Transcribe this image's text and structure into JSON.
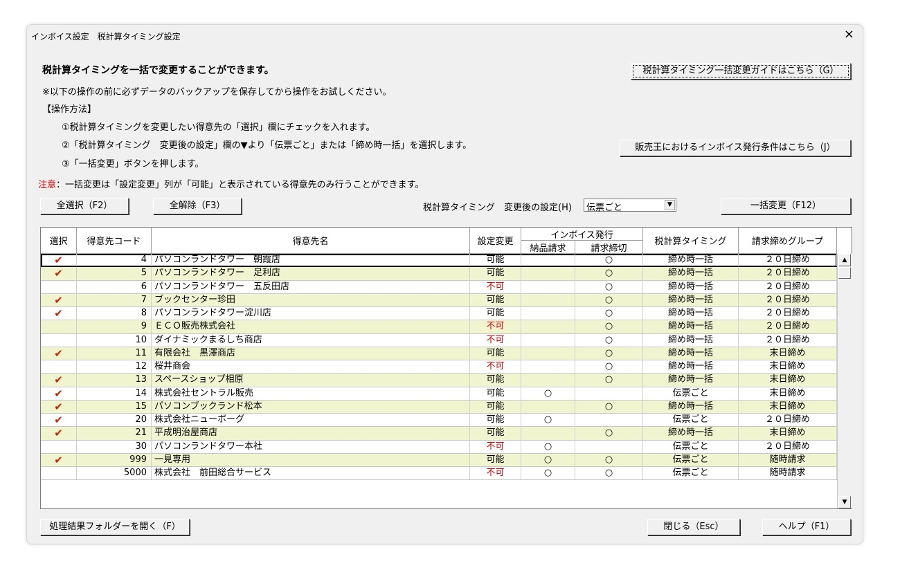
{
  "window": {
    "title": "インボイス設定　税計算タイミング設定",
    "close": "×"
  },
  "intro": {
    "heading": "税計算タイミングを一括で変更することができます。",
    "backup_note": "※以下の操作の前に必ずデータのバックアップを保存してから操作をお試しください。",
    "method_label": "【操作方法】",
    "step1": "①税計算タイミングを変更したい得意先の「選択」欄にチェックを入れます。",
    "step2": "②「税計算タイミング　変更後の設定」欄の▼より「伝票ごと」または「締め時一括」を選択します。",
    "step3": "③「一括変更」ボタンを押します。",
    "caution_label": "注意",
    "caution_text": "：一括変更は「設定変更」列が「可能」と表示されている得意先のみ行うことができます。"
  },
  "buttons": {
    "guide": "税計算タイミング一括変更ガイドはこちら（G）",
    "conditions": "販売王におけるインボイス発行条件はこちら（J）",
    "select_all": "全選択（F2）",
    "clear_all": "全解除（F3）",
    "bulk_change": "一括変更（F12）",
    "open_folder": "処理結果フォルダーを開く（F）",
    "close": "閉じる（Esc）",
    "help": "ヘルプ（F1）"
  },
  "setting": {
    "label": "税計算タイミング　変更後の設定(H)",
    "value": "伝票ごと"
  },
  "table": {
    "headers": {
      "select": "選択",
      "code": "得意先コード",
      "name": "得意先名",
      "setting": "設定変更",
      "invoice": "インボイス発行",
      "delivery": "納品請求",
      "billing": "請求締切",
      "timing": "税計算タイミング",
      "group": "請求締めグループ"
    },
    "rows": [
      {
        "chk": "✔",
        "code": "4",
        "name": "パソコンランドタワー　朝霞店",
        "set": "可能",
        "ok": true,
        "d": "",
        "b": "○",
        "timing": "締め時一括",
        "group": "２０日締め"
      },
      {
        "chk": "✔",
        "code": "5",
        "name": "パソコンランドタワー　足利店",
        "set": "可能",
        "ok": true,
        "d": "",
        "b": "○",
        "timing": "締め時一括",
        "group": "２０日締め"
      },
      {
        "chk": "",
        "code": "6",
        "name": "パソコンランドタワー　五反田店",
        "set": "不可",
        "ok": false,
        "d": "",
        "b": "○",
        "timing": "締め時一括",
        "group": "２０日締め"
      },
      {
        "chk": "✔",
        "code": "7",
        "name": "ブックセンター珍田",
        "set": "可能",
        "ok": true,
        "d": "",
        "b": "○",
        "timing": "締め時一括",
        "group": "２０日締め"
      },
      {
        "chk": "✔",
        "code": "8",
        "name": "パソコンランドタワー淀川店",
        "set": "可能",
        "ok": true,
        "d": "",
        "b": "○",
        "timing": "締め時一括",
        "group": "２０日締め"
      },
      {
        "chk": "",
        "code": "9",
        "name": "ＥＣＯ販売株式会社",
        "set": "不可",
        "ok": false,
        "d": "",
        "b": "○",
        "timing": "締め時一括",
        "group": "２０日締め"
      },
      {
        "chk": "",
        "code": "10",
        "name": "ダイナミックまるしち商店",
        "set": "不可",
        "ok": false,
        "d": "",
        "b": "○",
        "timing": "締め時一括",
        "group": "２０日締め"
      },
      {
        "chk": "✔",
        "code": "11",
        "name": "有限会社　黒澤商店",
        "set": "可能",
        "ok": true,
        "d": "",
        "b": "○",
        "timing": "締め時一括",
        "group": "末日締め"
      },
      {
        "chk": "",
        "code": "12",
        "name": "桜井商会",
        "set": "不可",
        "ok": false,
        "d": "",
        "b": "○",
        "timing": "締め時一括",
        "group": "末日締め"
      },
      {
        "chk": "✔",
        "code": "13",
        "name": "スペースショップ相原",
        "set": "可能",
        "ok": true,
        "d": "",
        "b": "○",
        "timing": "締め時一括",
        "group": "末日締め"
      },
      {
        "chk": "✔",
        "code": "14",
        "name": "株式会社セントラル販売",
        "set": "可能",
        "ok": true,
        "d": "○",
        "b": "",
        "timing": "伝票ごと",
        "group": "末日締め"
      },
      {
        "chk": "✔",
        "code": "15",
        "name": "パソコンブックランド松本",
        "set": "可能",
        "ok": true,
        "d": "",
        "b": "○",
        "timing": "締め時一括",
        "group": "末日締め"
      },
      {
        "chk": "✔",
        "code": "20",
        "name": "株式会社ニューボーグ",
        "set": "可能",
        "ok": true,
        "d": "○",
        "b": "",
        "timing": "伝票ごと",
        "group": "２０日締め"
      },
      {
        "chk": "✔",
        "code": "21",
        "name": "平成明治屋商店",
        "set": "可能",
        "ok": true,
        "d": "",
        "b": "○",
        "timing": "締め時一括",
        "group": "末日締め"
      },
      {
        "chk": "",
        "code": "30",
        "name": "パソコンランドタワー本社",
        "set": "不可",
        "ok": false,
        "d": "○",
        "b": "",
        "timing": "伝票ごと",
        "group": "２０日締め"
      },
      {
        "chk": "✔",
        "code": "999",
        "name": "一見専用",
        "set": "可能",
        "ok": true,
        "d": "○",
        "b": "○",
        "timing": "伝票ごと",
        "group": "随時請求"
      },
      {
        "chk": "",
        "code": "5000",
        "name": "株式会社　前田総合サービス",
        "set": "不可",
        "ok": false,
        "d": "○",
        "b": "○",
        "timing": "伝票ごと",
        "group": "随時請求"
      }
    ]
  },
  "icons": {
    "checkmark": "checkmark-icon",
    "scroll_up": "scroll-up-icon",
    "scroll_down": "scroll-down-icon",
    "dropdown": "chevron-down-icon"
  },
  "colors": {
    "caution": "#e00000",
    "check": "#cc2200",
    "alt_row": "#f0f5d0"
  }
}
